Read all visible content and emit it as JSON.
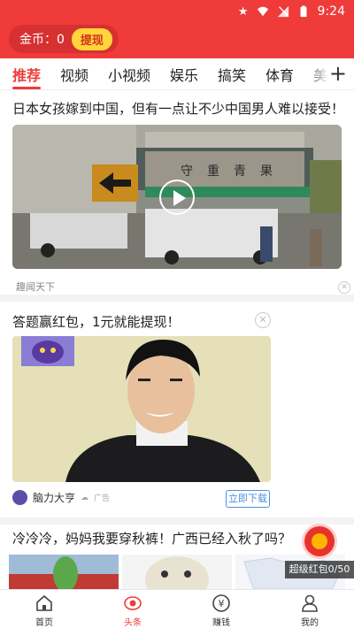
{
  "status_bar": {
    "time": "9:24"
  },
  "header": {
    "coin_label": "金币：0",
    "withdraw_label": "提现"
  },
  "tabs": [
    "推荐",
    "视频",
    "小视频",
    "娱乐",
    "搞笑",
    "体育",
    "美"
  ],
  "feed": {
    "article1": {
      "title": "日本女孩嫁到中国，但有一点让不少中国男人难以接受！",
      "source": "趣闻天下"
    },
    "ad": {
      "title": "答题赢红包，1元就能提现！",
      "advertiser": "脑力大亨",
      "ad_tag": "广告",
      "download_label": "立即下载"
    },
    "article2": {
      "title": "冷冷冷，妈妈我要穿秋裤！广西已经入秋了吗？"
    }
  },
  "floating": {
    "redpack_label": "超级红包0/50"
  },
  "bottom_nav": [
    {
      "label": "首页",
      "icon": "home-icon"
    },
    {
      "label": "头条",
      "icon": "eye-icon"
    },
    {
      "label": "赚钱",
      "icon": "yuan-icon"
    },
    {
      "label": "我的",
      "icon": "user-icon"
    }
  ],
  "colors": {
    "brand_red": "#ef3b3a",
    "coin_yellow": "#ffd53a",
    "link_blue": "#4a90e2"
  }
}
